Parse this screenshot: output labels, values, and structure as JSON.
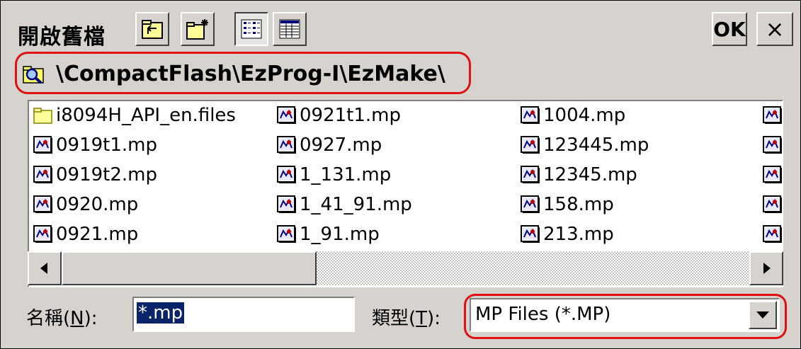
{
  "window": {
    "title": "開啟舊檔",
    "ok_label": "OK",
    "close_label": "×"
  },
  "toolbar": {
    "buttons": [
      {
        "icon": "up-folder-icon"
      },
      {
        "icon": "new-folder-icon"
      },
      {
        "icon": "list-view-icon",
        "pressed": true
      },
      {
        "icon": "details-view-icon"
      }
    ]
  },
  "path": {
    "icon": "search-folder-icon",
    "text": "\\CompactFlash\\EzProg-I\\EzMake\\"
  },
  "files": {
    "columns": [
      [
        {
          "name": "i8094H_API_en.files",
          "type": "folder"
        },
        {
          "name": "0919t1.mp",
          "type": "mp"
        },
        {
          "name": "0919t2.mp",
          "type": "mp"
        },
        {
          "name": "0920.mp",
          "type": "mp"
        },
        {
          "name": "0921.mp",
          "type": "mp"
        }
      ],
      [
        {
          "name": "0921t1.mp",
          "type": "mp"
        },
        {
          "name": "0927.mp",
          "type": "mp"
        },
        {
          "name": "1_131.mp",
          "type": "mp"
        },
        {
          "name": "1_41_91.mp",
          "type": "mp"
        },
        {
          "name": "1_91.mp",
          "type": "mp"
        }
      ],
      [
        {
          "name": "1004.mp",
          "type": "mp"
        },
        {
          "name": "123445.mp",
          "type": "mp"
        },
        {
          "name": "12345.mp",
          "type": "mp"
        },
        {
          "name": "158.mp",
          "type": "mp"
        },
        {
          "name": "213.mp",
          "type": "mp"
        }
      ]
    ]
  },
  "bottom": {
    "name_label_prefix": "名稱(",
    "name_label_key": "N",
    "name_label_suffix": "):",
    "name_value": "*.mp",
    "type_label_prefix": "類型(",
    "type_label_key": "T",
    "type_label_suffix": "):",
    "type_value": "MP Files (*.MP)"
  },
  "colors": {
    "highlight": "#e01010",
    "selection": "#0a246a",
    "dialog_bg": "#d6d3ce"
  }
}
